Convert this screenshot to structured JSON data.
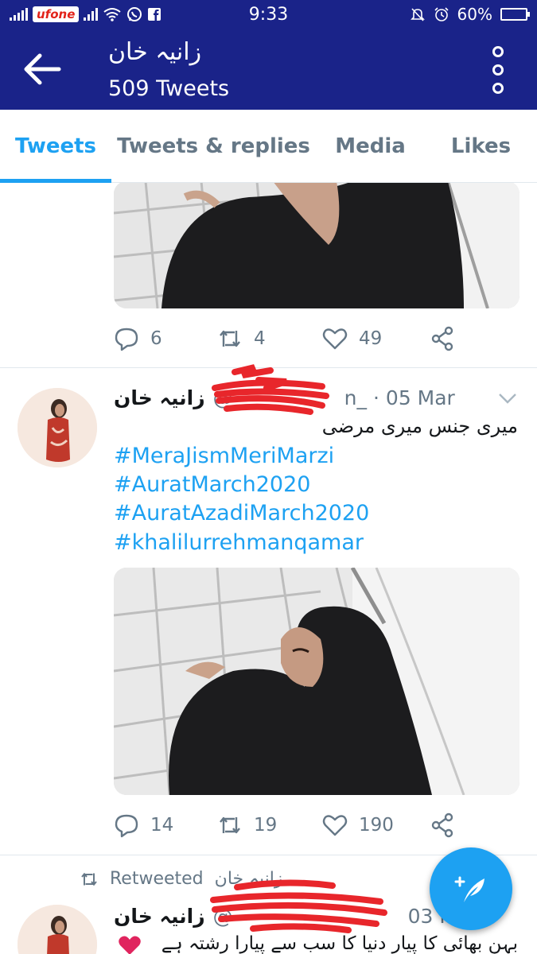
{
  "status_bar": {
    "carrier": "ufone",
    "time": "9:33",
    "battery": "60%",
    "battery_level": 0.6,
    "icons": [
      "signal-icon",
      "wifi-icon",
      "whatsapp-icon",
      "facebook-icon",
      "mute-icon",
      "alarm-icon",
      "battery-icon"
    ]
  },
  "app_bar": {
    "title": "زانیہ خان",
    "subtitle": "509 Tweets"
  },
  "tabs": [
    {
      "label": "Tweets",
      "active": true
    },
    {
      "label": "Tweets & replies",
      "active": false
    },
    {
      "label": "Media",
      "active": false
    },
    {
      "label": "Likes",
      "active": false
    }
  ],
  "tweets": [
    {
      "replies": "6",
      "retweets": "4",
      "likes": "49"
    },
    {
      "name": "زانیہ خان",
      "handle": "@",
      "handle_suffix": "n_",
      "time": "· 05 Mar",
      "text": "میری جنس میری مرضی",
      "hashtags": [
        "#MeraJismMeriMarzi",
        "#AuratMarch2020",
        "#AuratAzadiMarch2020",
        "#khalilurrehmanqamar"
      ],
      "replies": "14",
      "retweets": "19",
      "likes": "190"
    },
    {
      "retweeted_label": "Retweeted",
      "retweeted_by": "زانیہ خان",
      "name": "زانیہ خان",
      "handle": "@",
      "time": "03 Mar",
      "text": "بہن بھائی کا پیار دنیا کا سب سے پیارا رشتہ ہے"
    }
  ],
  "colors": {
    "header": "#1a2389",
    "accent": "#1da1f2",
    "muted": "#657786",
    "redaction": "#e8262b"
  }
}
